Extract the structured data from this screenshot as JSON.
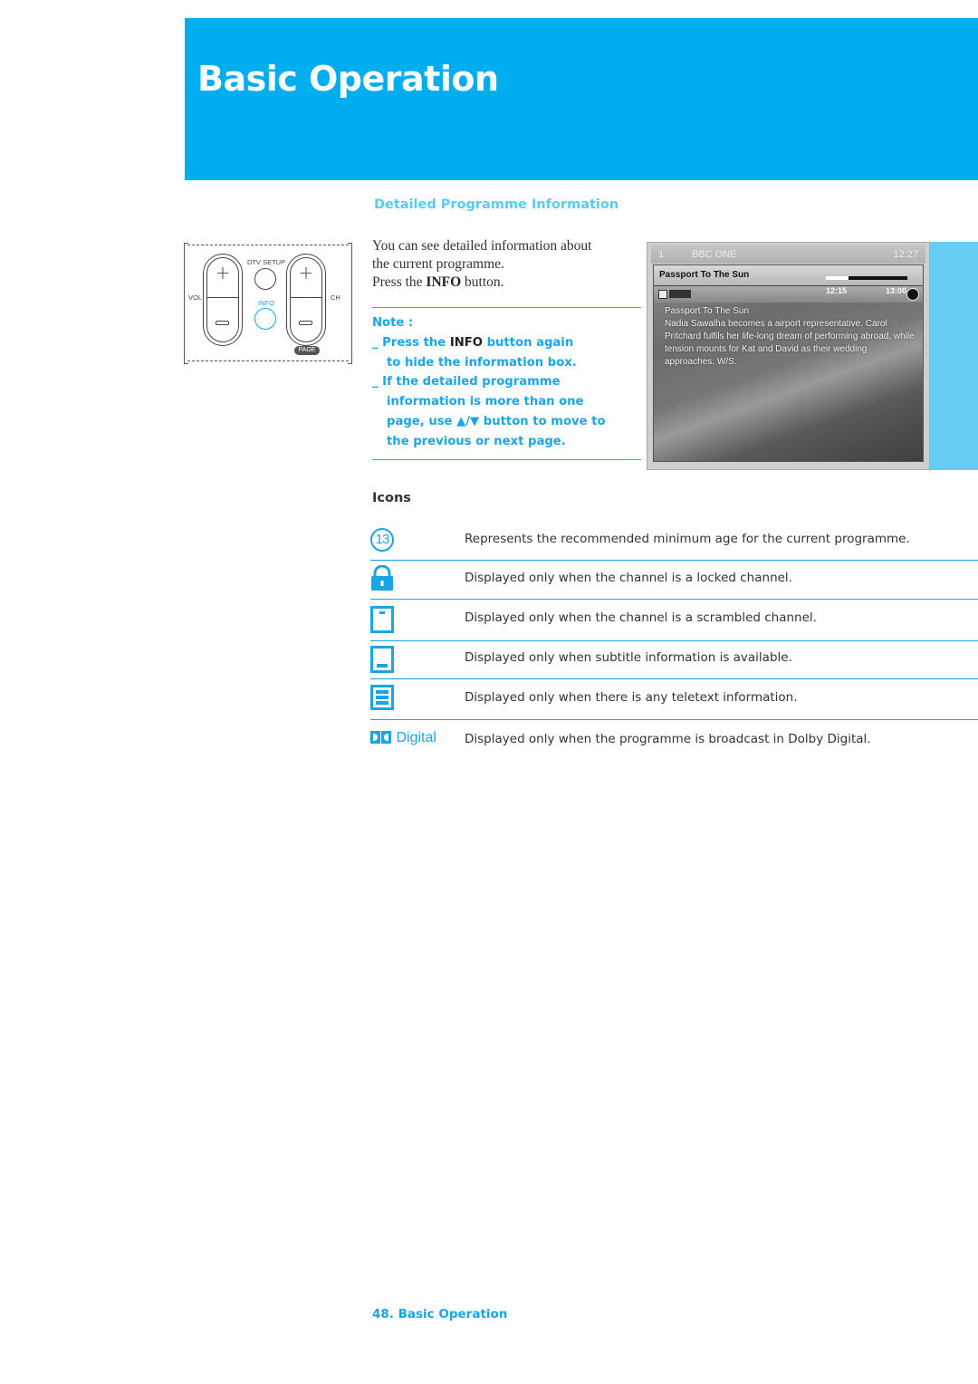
{
  "header": {
    "title": "Basic Operation"
  },
  "section": {
    "title": "Detailed Programme Information"
  },
  "remote": {
    "vol_label": "VOL",
    "ch_label": "CH",
    "dtv_setup_label": "DTV SETUP",
    "info_label": "INFO",
    "page_label": "PAGE",
    "plus_symbol": "+"
  },
  "intro": {
    "line1": "You can see detailed information about",
    "line2": "the current programme.",
    "line3_pre": "Press the ",
    "line3_bold": "INFO",
    "line3_post": " button."
  },
  "note": {
    "heading": "Note :",
    "item1_prefix": "_ Press the ",
    "item1_bold": "INFO",
    "item1_suffix": " button again",
    "item1_line2": "to hide the information box.",
    "item2_line1": "_ If the detailed programme",
    "item2_line2": "information is more than one",
    "item2_line3": "page, use ▲/▼ button to move to",
    "item2_line4": "the previous or next page."
  },
  "tv_screen": {
    "channel_number": "1",
    "channel_name": "BBC ONE",
    "clock": "12:27",
    "programme_title": "Passport To The Sun",
    "start_time": "12:15",
    "end_time": "13:00",
    "progress": 0.28,
    "description_title": "Passport To The Sun",
    "description": "Nadia Sawalha becomes a airport representative. Carol Pritchard fulfils her life-long dream of performing abroad, while tension mounts for Kat and David as their wedding approaches. W/S."
  },
  "icons_section": {
    "title": "Icons",
    "items": [
      {
        "icon": "age-rating-13-icon",
        "glyph": "13",
        "description": "Represents the recommended minimum age for the current programme."
      },
      {
        "icon": "lock-icon",
        "description": "Displayed only when the channel is a locked channel."
      },
      {
        "icon": "scrambled-icon",
        "description": "Displayed only when the channel is a scrambled channel."
      },
      {
        "icon": "subtitle-icon",
        "description": "Displayed only when subtitle information is available."
      },
      {
        "icon": "teletext-icon",
        "description": "Displayed only when there is any teletext information."
      },
      {
        "icon": "dolby-digital-icon",
        "glyph": "Digital",
        "description": "Displayed only when the programme is broadcast in Dolby Digital."
      }
    ]
  },
  "footer": {
    "page_label": "48. Basic Operation"
  },
  "colors": {
    "brand_blue": "#00aeef",
    "accent_blue": "#1aa6e6",
    "light_blue": "#67cdf5",
    "section_title": "#5ccaf3"
  }
}
